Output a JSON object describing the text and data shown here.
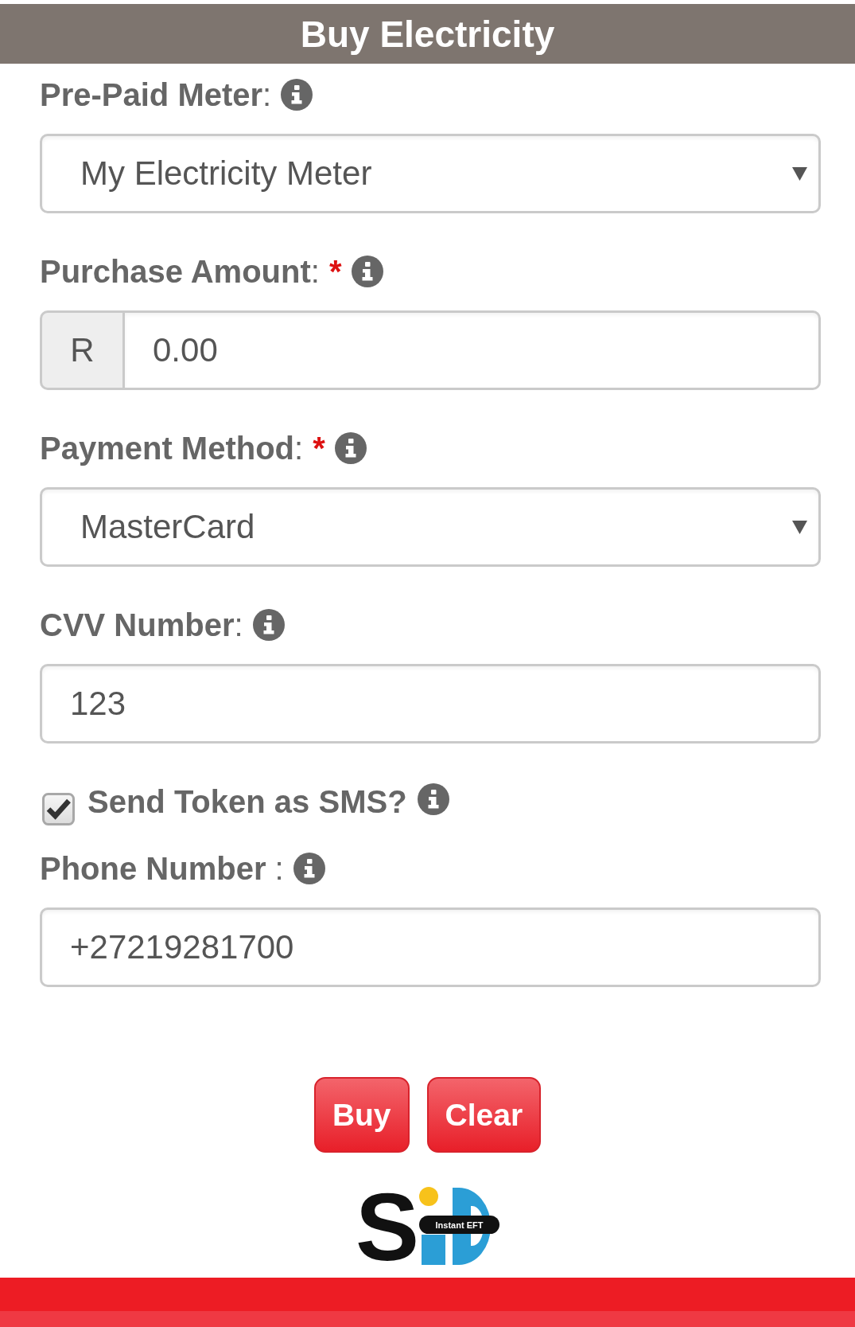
{
  "header": {
    "title": "Buy Electricity"
  },
  "form": {
    "fields": [
      {
        "kind": "select",
        "label": "**Pre-Paid Meter**:",
        "value": "My Electricity Meter"
      },
      {
        "kind": "currency",
        "label": "**Purchase Amount**:",
        "required_mark": "*",
        "prefix": "R",
        "value": "0.00"
      },
      {
        "kind": "select",
        "label": "**Payment Method**:",
        "required_mark": "*",
        "value": "MasterCard"
      },
      {
        "kind": "text",
        "label": "**CVV Number**:",
        "value": "123"
      },
      {
        "kind": "checkbox",
        "label": "Send Token as SMS?",
        "checked": true
      },
      {
        "kind": "text",
        "label": "**Phone Number** :",
        "value": "+27219281700"
      }
    ]
  },
  "buttons": [
    {
      "label": "Buy"
    },
    {
      "label": "Clear"
    }
  ],
  "logo": {
    "letter": "S",
    "tagline": "Instant EFT"
  }
}
